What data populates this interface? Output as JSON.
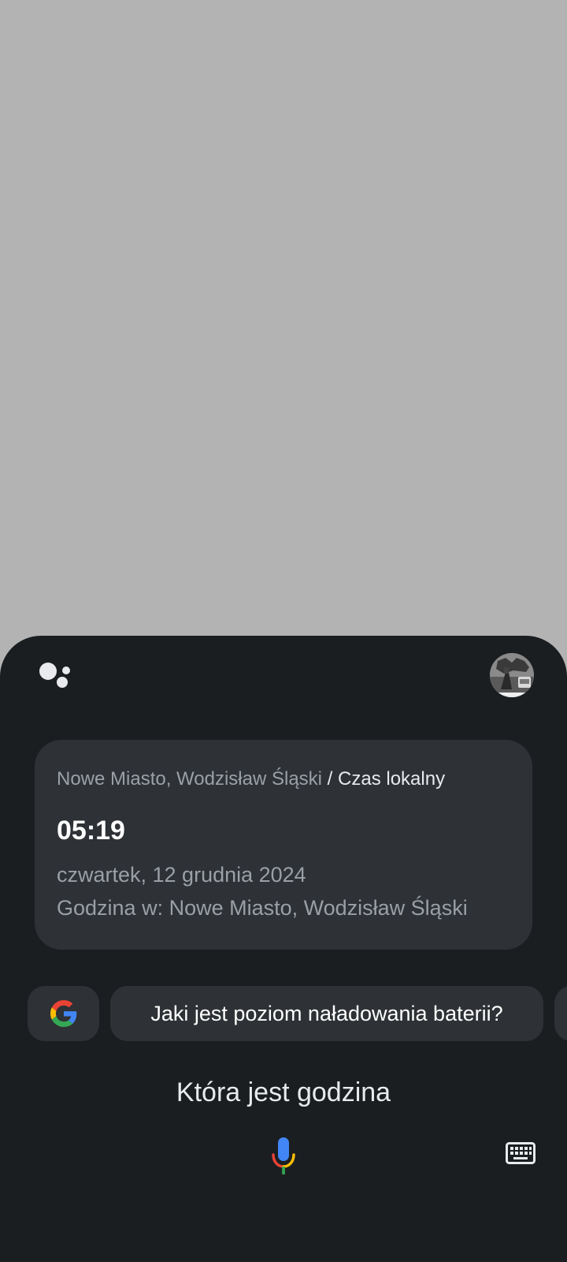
{
  "card": {
    "location": "Nowe Miasto, Wodzisław Śląski",
    "separator": " / ",
    "kind": "Czas lokalny",
    "time": "05:19",
    "date": "czwartek, 12 grudnia 2024",
    "place": "Godzina w: Nowe Miasto, Wodzisław Śląski"
  },
  "suggestions": {
    "battery": "Jaki jest poziom naładowania baterii?"
  },
  "query": "Która jest godzina",
  "icons": {
    "assistant": "google-assistant-icon",
    "google": "google-g-icon",
    "mic": "mic-icon",
    "keyboard": "keyboard-icon"
  },
  "colors": {
    "sheet": "#1b1e21",
    "card": "#2e3135",
    "scrim": "#b3b3b3"
  }
}
